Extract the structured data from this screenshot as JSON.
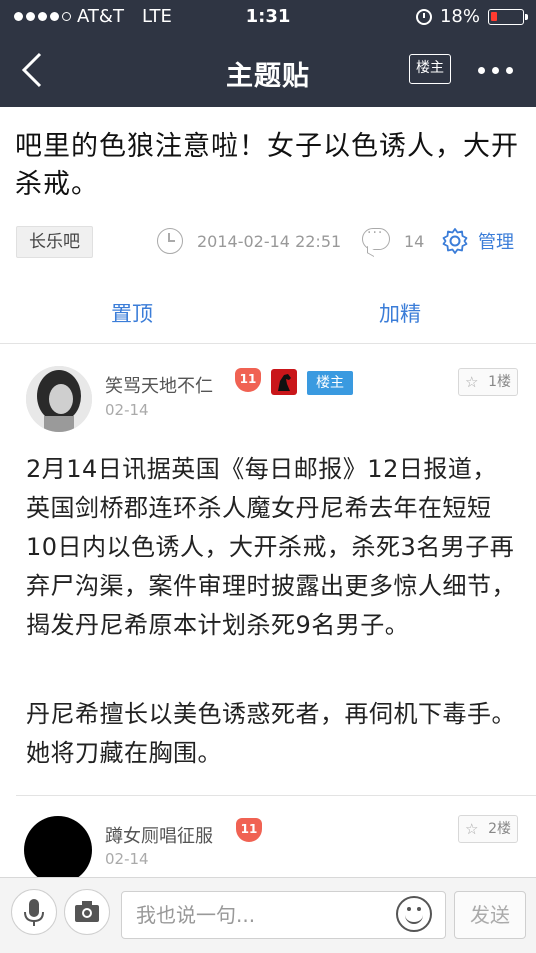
{
  "status_bar": {
    "carrier": "AT&T",
    "network": "LTE",
    "time": "1:31",
    "battery": "18%",
    "signal_bars": 4,
    "battery_level": 0.18
  },
  "nav": {
    "title": "主题贴",
    "owner_button": "楼主"
  },
  "post": {
    "title": "吧里的色狼注意啦！女子以色诱人，大开杀戒。",
    "forum": "长乐吧",
    "datetime": "2014-02-14 22:51",
    "reply_count": "14",
    "manage_label": "管理",
    "actions": {
      "pin": "置顶",
      "feature": "加精"
    }
  },
  "floors": [
    {
      "username": "笑骂天地不仁",
      "level": "11",
      "tag": "楼主",
      "date": "02-14",
      "floor": "1楼",
      "paragraphs": [
        "2月14日讯据英国《每日邮报》12日报道，英国剑桥郡连环杀人魔女丹尼希去年在短短10日内以色诱人，大开杀戒，杀死3名男子再弃尸沟渠，案件审理时披露出更多惊人细节，揭发丹尼希原本计划杀死9名男子。",
        "丹尼希擅长以美色诱惑死者，再伺机下毒手。她将刀藏在胸围。"
      ]
    },
    {
      "username": "蹲女厕唱征服",
      "level": "11",
      "date": "02-14",
      "floor": "2楼"
    }
  ],
  "reply_bar": {
    "placeholder": "我也说一句...",
    "send_label": "发送"
  },
  "colors": {
    "header_bg": "#2f3543",
    "link_blue": "#3b7dd8",
    "level_badge": "#f06253",
    "owner_tag": "#3a9ae0"
  }
}
